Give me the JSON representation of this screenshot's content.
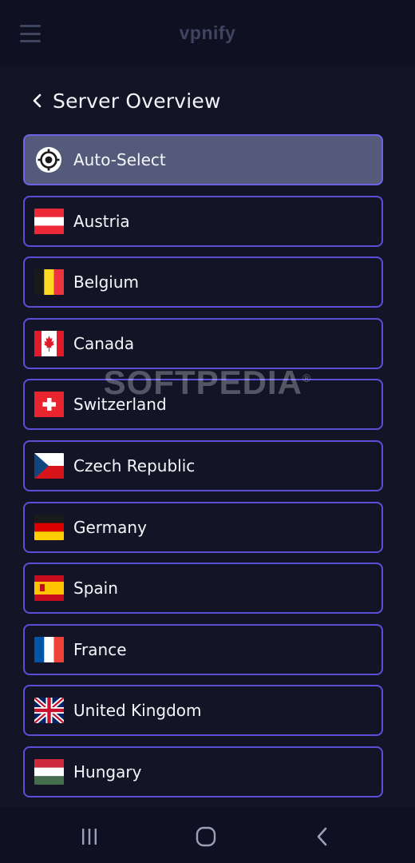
{
  "app": {
    "brand": "vpnify"
  },
  "header": {
    "title": "Server Overview"
  },
  "servers": [
    {
      "label": "Auto-Select",
      "icon": "target-icon",
      "selected": true
    },
    {
      "label": "Austria",
      "icon": "flag-austria-icon"
    },
    {
      "label": "Belgium",
      "icon": "flag-belgium-icon"
    },
    {
      "label": "Canada",
      "icon": "flag-canada-icon"
    },
    {
      "label": "Switzerland",
      "icon": "flag-switzerland-icon"
    },
    {
      "label": "Czech Republic",
      "icon": "flag-czech-republic-icon"
    },
    {
      "label": "Germany",
      "icon": "flag-germany-icon"
    },
    {
      "label": "Spain",
      "icon": "flag-spain-icon"
    },
    {
      "label": "France",
      "icon": "flag-france-icon"
    },
    {
      "label": "United Kingdom",
      "icon": "flag-united-kingdom-icon"
    },
    {
      "label": "Hungary",
      "icon": "flag-hungary-icon"
    }
  ],
  "watermark": "SOFTPEDIA",
  "colors": {
    "background": "#131527",
    "accent_border": "#5b4fd8",
    "selected_fill": "#545b7a"
  }
}
